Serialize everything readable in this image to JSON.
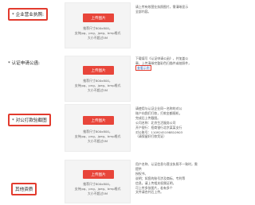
{
  "sections": [
    {
      "label": "* 企业营业执照:",
      "upload_label": "上传图片",
      "spec": [
        "推荐尺寸800x800，",
        "支持jpg、png、jpeg、bmp格式",
        "大小不超过5M"
      ],
      "hint": [
        "请上传有效营业执照图片，需清晰显示",
        "全部内容。"
      ]
    },
    {
      "label": "* 认证申请公函:",
      "upload_label": "上传图片",
      "spec": [
        "推荐尺寸800x800，",
        "支持jpg、png、jpeg、bmp格式",
        "大小不超过5M"
      ],
      "hint": [
        "下载填写《认证申请公函》，并加盖公",
        "章，上传清晰完整彩色扫描件或拍照件，",
        "查看示例"
      ],
      "template_link": "认证申请公函",
      "example_link": "查看示例"
    },
    {
      "label": "* 对公打款验截图",
      "upload_label": "上传图片",
      "spec": [
        "推荐尺寸800x800，",
        "支持jpg、png、jpeg、bmp格式",
        "大小不超过5M"
      ],
      "hint": [
        "请使用与认证企业同一名称的对公",
        "账户向我们打款，打款金额随机，",
        "完成后上传截图。",
        "公司名称：北京生活服务公司",
        "开户银行：招商银行北京某某支行",
        "对公账号：1109245198810903",
        "（请保留好打款凭证）"
      ]
    },
    {
      "label": "其他资质",
      "upload_label": "上传图片",
      "spec": [
        "推荐尺寸800x800，",
        "支持jpg、png、jpeg、bmp格式",
        "大小不超过5M"
      ],
      "hint": [
        "用户名称、认证信息与营业执照不一致时，需提供",
        "授权书、",
        "说明；如您的账号涉及商标、专利等",
        "信息，请上传相关权属证明，",
        "可上传多张图片，若有多个",
        "文件请合并后上传。"
      ]
    }
  ]
}
